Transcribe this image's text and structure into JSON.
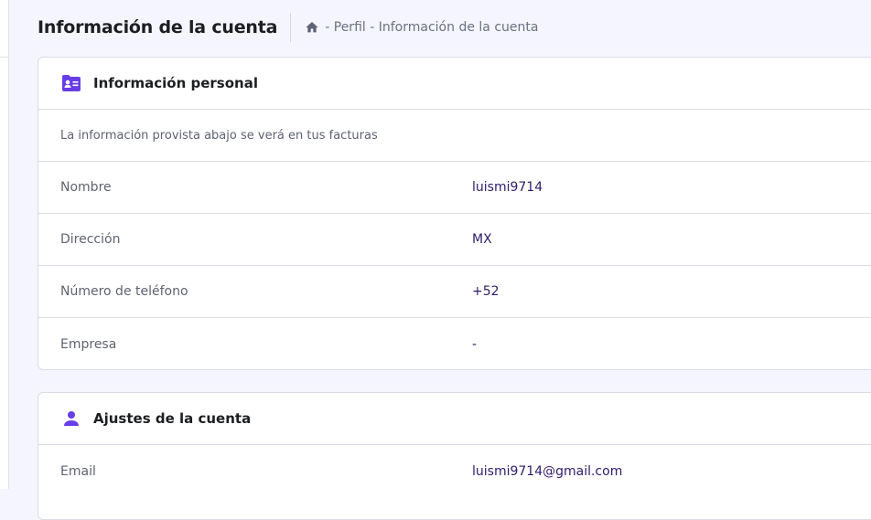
{
  "page": {
    "title": "Información de la cuenta"
  },
  "breadcrumb": {
    "home_icon": "home-icon",
    "separator": "-",
    "items": [
      "Perfil",
      "Información de la cuenta"
    ]
  },
  "personal": {
    "icon": "contact-card-icon",
    "title": "Información personal",
    "note": "La información provista abajo se verá en tus facturas",
    "rows": [
      {
        "label": "Nombre",
        "value": "luismi9714"
      },
      {
        "label": "Dirección",
        "value": "MX"
      },
      {
        "label": "Número de teléfono",
        "value": "+52"
      },
      {
        "label": "Empresa",
        "value": "-"
      }
    ]
  },
  "account": {
    "icon": "user-icon",
    "title": "Ajustes de la cuenta",
    "rows": [
      {
        "label": "Email",
        "value": "luismi9714@gmail.com"
      }
    ]
  },
  "colors": {
    "accent": "#673de6",
    "background": "#f4f5ff",
    "text": "#1d1e20",
    "muted": "#5f6272"
  }
}
